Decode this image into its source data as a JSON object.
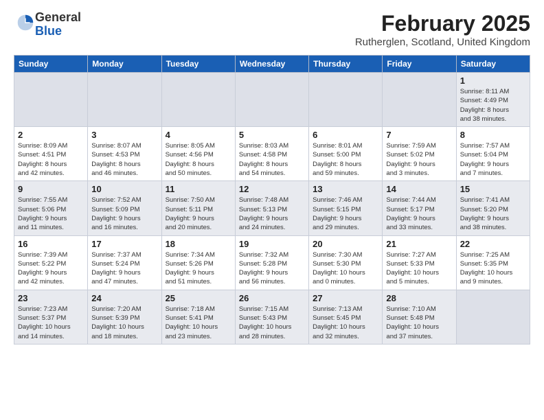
{
  "header": {
    "logo_line1": "General",
    "logo_line2": "Blue",
    "month_title": "February 2025",
    "location": "Rutherglen, Scotland, United Kingdom"
  },
  "weekdays": [
    "Sunday",
    "Monday",
    "Tuesday",
    "Wednesday",
    "Thursday",
    "Friday",
    "Saturday"
  ],
  "rows": [
    {
      "cells": [
        {
          "day": "",
          "info": ""
        },
        {
          "day": "",
          "info": ""
        },
        {
          "day": "",
          "info": ""
        },
        {
          "day": "",
          "info": ""
        },
        {
          "day": "",
          "info": ""
        },
        {
          "day": "",
          "info": ""
        },
        {
          "day": "1",
          "info": "Sunrise: 8:11 AM\nSunset: 4:49 PM\nDaylight: 8 hours\nand 38 minutes."
        }
      ]
    },
    {
      "cells": [
        {
          "day": "2",
          "info": "Sunrise: 8:09 AM\nSunset: 4:51 PM\nDaylight: 8 hours\nand 42 minutes."
        },
        {
          "day": "3",
          "info": "Sunrise: 8:07 AM\nSunset: 4:53 PM\nDaylight: 8 hours\nand 46 minutes."
        },
        {
          "day": "4",
          "info": "Sunrise: 8:05 AM\nSunset: 4:56 PM\nDaylight: 8 hours\nand 50 minutes."
        },
        {
          "day": "5",
          "info": "Sunrise: 8:03 AM\nSunset: 4:58 PM\nDaylight: 8 hours\nand 54 minutes."
        },
        {
          "day": "6",
          "info": "Sunrise: 8:01 AM\nSunset: 5:00 PM\nDaylight: 8 hours\nand 59 minutes."
        },
        {
          "day": "7",
          "info": "Sunrise: 7:59 AM\nSunset: 5:02 PM\nDaylight: 9 hours\nand 3 minutes."
        },
        {
          "day": "8",
          "info": "Sunrise: 7:57 AM\nSunset: 5:04 PM\nDaylight: 9 hours\nand 7 minutes."
        }
      ]
    },
    {
      "cells": [
        {
          "day": "9",
          "info": "Sunrise: 7:55 AM\nSunset: 5:06 PM\nDaylight: 9 hours\nand 11 minutes."
        },
        {
          "day": "10",
          "info": "Sunrise: 7:52 AM\nSunset: 5:09 PM\nDaylight: 9 hours\nand 16 minutes."
        },
        {
          "day": "11",
          "info": "Sunrise: 7:50 AM\nSunset: 5:11 PM\nDaylight: 9 hours\nand 20 minutes."
        },
        {
          "day": "12",
          "info": "Sunrise: 7:48 AM\nSunset: 5:13 PM\nDaylight: 9 hours\nand 24 minutes."
        },
        {
          "day": "13",
          "info": "Sunrise: 7:46 AM\nSunset: 5:15 PM\nDaylight: 9 hours\nand 29 minutes."
        },
        {
          "day": "14",
          "info": "Sunrise: 7:44 AM\nSunset: 5:17 PM\nDaylight: 9 hours\nand 33 minutes."
        },
        {
          "day": "15",
          "info": "Sunrise: 7:41 AM\nSunset: 5:20 PM\nDaylight: 9 hours\nand 38 minutes."
        }
      ]
    },
    {
      "cells": [
        {
          "day": "16",
          "info": "Sunrise: 7:39 AM\nSunset: 5:22 PM\nDaylight: 9 hours\nand 42 minutes."
        },
        {
          "day": "17",
          "info": "Sunrise: 7:37 AM\nSunset: 5:24 PM\nDaylight: 9 hours\nand 47 minutes."
        },
        {
          "day": "18",
          "info": "Sunrise: 7:34 AM\nSunset: 5:26 PM\nDaylight: 9 hours\nand 51 minutes."
        },
        {
          "day": "19",
          "info": "Sunrise: 7:32 AM\nSunset: 5:28 PM\nDaylight: 9 hours\nand 56 minutes."
        },
        {
          "day": "20",
          "info": "Sunrise: 7:30 AM\nSunset: 5:30 PM\nDaylight: 10 hours\nand 0 minutes."
        },
        {
          "day": "21",
          "info": "Sunrise: 7:27 AM\nSunset: 5:33 PM\nDaylight: 10 hours\nand 5 minutes."
        },
        {
          "day": "22",
          "info": "Sunrise: 7:25 AM\nSunset: 5:35 PM\nDaylight: 10 hours\nand 9 minutes."
        }
      ]
    },
    {
      "cells": [
        {
          "day": "23",
          "info": "Sunrise: 7:23 AM\nSunset: 5:37 PM\nDaylight: 10 hours\nand 14 minutes."
        },
        {
          "day": "24",
          "info": "Sunrise: 7:20 AM\nSunset: 5:39 PM\nDaylight: 10 hours\nand 18 minutes."
        },
        {
          "day": "25",
          "info": "Sunrise: 7:18 AM\nSunset: 5:41 PM\nDaylight: 10 hours\nand 23 minutes."
        },
        {
          "day": "26",
          "info": "Sunrise: 7:15 AM\nSunset: 5:43 PM\nDaylight: 10 hours\nand 28 minutes."
        },
        {
          "day": "27",
          "info": "Sunrise: 7:13 AM\nSunset: 5:45 PM\nDaylight: 10 hours\nand 32 minutes."
        },
        {
          "day": "28",
          "info": "Sunrise: 7:10 AM\nSunset: 5:48 PM\nDaylight: 10 hours\nand 37 minutes."
        },
        {
          "day": "",
          "info": ""
        }
      ]
    }
  ],
  "row_styles": [
    "gray",
    "white",
    "gray",
    "white",
    "gray"
  ]
}
